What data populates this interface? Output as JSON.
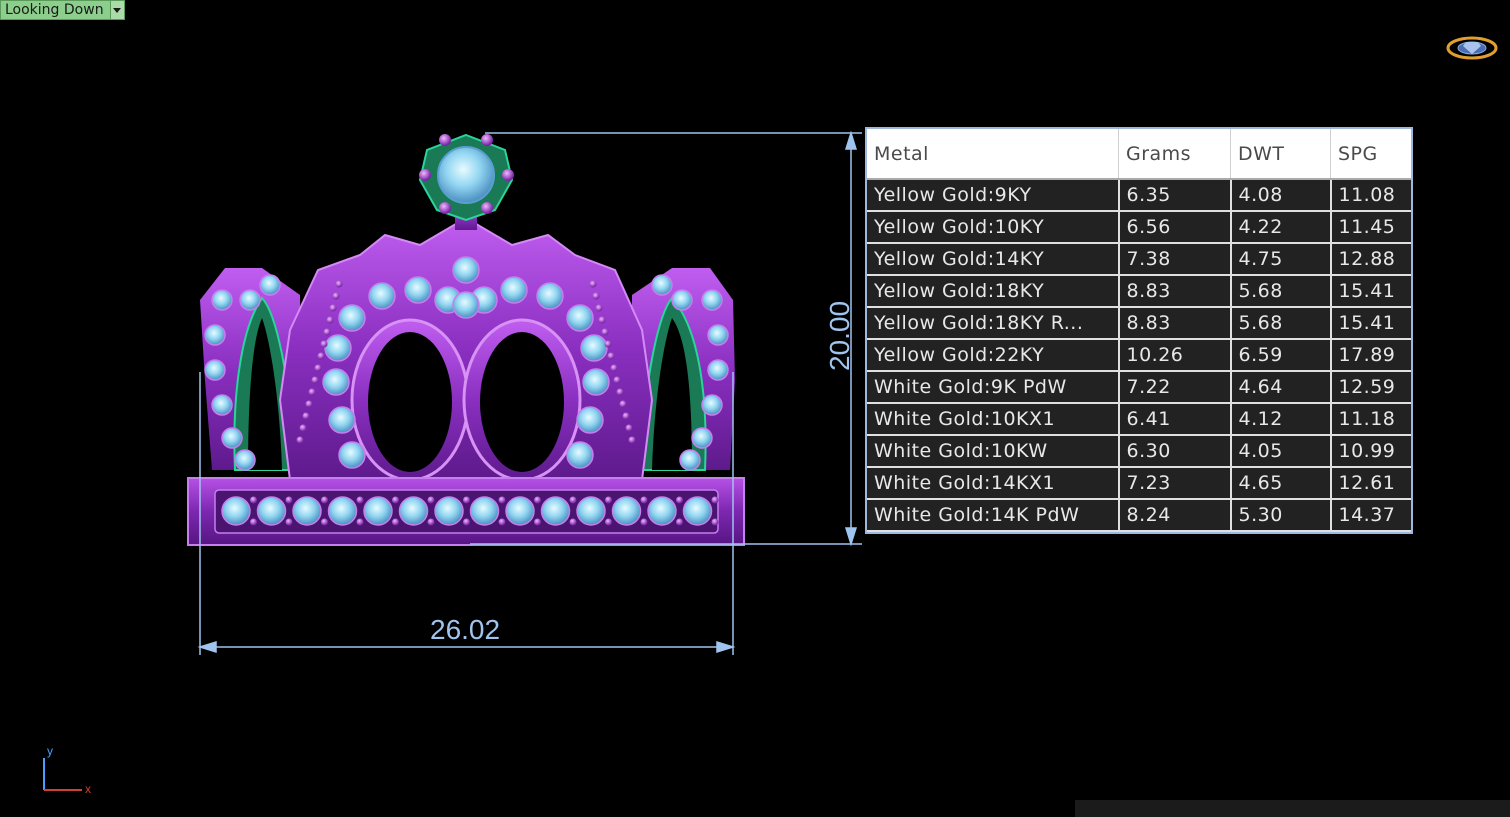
{
  "viewport": {
    "view_name": "Looking Down"
  },
  "dimensions": {
    "width_label": "26.02",
    "height_label": "20.00"
  },
  "axes": {
    "y_label": "y",
    "x_label": "x"
  },
  "weight_table": {
    "headers": [
      "Metal",
      "Grams",
      "DWT",
      "SPG"
    ],
    "rows": [
      [
        "Yellow Gold:9KY",
        "6.35",
        "4.08",
        "11.08"
      ],
      [
        "Yellow Gold:10KY",
        "6.56",
        "4.22",
        "11.45"
      ],
      [
        "Yellow Gold:14KY",
        "7.38",
        "4.75",
        "12.88"
      ],
      [
        "Yellow Gold:18KY",
        "8.83",
        "5.68",
        "15.41"
      ],
      [
        "Yellow Gold:18KY R...",
        "8.83",
        "5.68",
        "15.41"
      ],
      [
        "Yellow Gold:22KY",
        "10.26",
        "6.59",
        "17.89"
      ],
      [
        "White Gold:9K PdW",
        "7.22",
        "4.64",
        "12.59"
      ],
      [
        "White Gold:10KX1",
        "6.41",
        "4.12",
        "11.18"
      ],
      [
        "White Gold:10KW",
        "6.30",
        "4.05",
        "10.99"
      ],
      [
        "White Gold:14KX1",
        "7.23",
        "4.65",
        "12.61"
      ],
      [
        "White Gold:14K PdW",
        "8.24",
        "5.30",
        "14.37"
      ]
    ]
  },
  "colors": {
    "background": "#000000",
    "crown_metal": "#8a2fc0",
    "crown_inner": "#1f8a5e",
    "gem": "#8ed4f0",
    "dimension_line": "#9fc4ee",
    "view_label_bg": "#8ccf8c"
  },
  "icons": {
    "corner_logo": "gem-ring-icon"
  }
}
